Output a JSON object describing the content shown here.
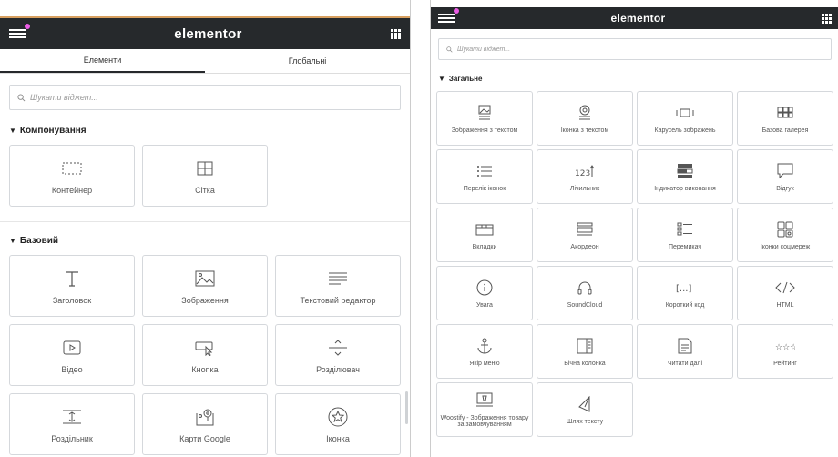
{
  "left": {
    "logo": "elementor",
    "tabs": [
      "Елементи",
      "Глобальні"
    ],
    "search_placeholder": "Шукати віджет...",
    "sections": [
      {
        "title": "Компонування",
        "items": [
          {
            "label": "Контейнер",
            "icon": "container-icon"
          },
          {
            "label": "Сітка",
            "icon": "grid-icon"
          }
        ]
      },
      {
        "title": "Базовий",
        "items": [
          {
            "label": "Заголовок",
            "icon": "heading-icon"
          },
          {
            "label": "Зображення",
            "icon": "image-icon"
          },
          {
            "label": "Текстовий редактор",
            "icon": "text-editor-icon"
          },
          {
            "label": "Відео",
            "icon": "video-icon"
          },
          {
            "label": "Кнопка",
            "icon": "button-icon"
          },
          {
            "label": "Розділювач",
            "icon": "divider-icon"
          },
          {
            "label": "Роздільник",
            "icon": "spacer-icon"
          },
          {
            "label": "Карти Google",
            "icon": "google-maps-icon"
          },
          {
            "label": "Іконка",
            "icon": "star-icon"
          }
        ]
      }
    ]
  },
  "right": {
    "logo": "elementor",
    "search_placeholder": "Шукати віджет...",
    "section_title": "Загальне",
    "items": [
      {
        "label": "Зображення з текстом",
        "icon": "image-box-icon"
      },
      {
        "label": "Іконка з текстом",
        "icon": "icon-box-icon"
      },
      {
        "label": "Карусель зображень",
        "icon": "carousel-icon"
      },
      {
        "label": "Базова галерея",
        "icon": "gallery-icon"
      },
      {
        "label": "Перелік іконок",
        "icon": "icon-list-icon"
      },
      {
        "label": "Лічильник",
        "icon": "counter-icon"
      },
      {
        "label": "Індикатор виконання",
        "icon": "progress-icon"
      },
      {
        "label": "Відгук",
        "icon": "testimonial-icon"
      },
      {
        "label": "Вкладки",
        "icon": "tabs-icon"
      },
      {
        "label": "Акордеон",
        "icon": "accordion-icon"
      },
      {
        "label": "Перемикач",
        "icon": "toggle-icon"
      },
      {
        "label": "Іконки соцмереж",
        "icon": "social-icon"
      },
      {
        "label": "Увага",
        "icon": "alert-icon"
      },
      {
        "label": "SoundCloud",
        "icon": "soundcloud-icon"
      },
      {
        "label": "Короткий код",
        "icon": "shortcode-icon"
      },
      {
        "label": "HTML",
        "icon": "html-icon"
      },
      {
        "label": "Якір меню",
        "icon": "anchor-icon"
      },
      {
        "label": "Бічна колонка",
        "icon": "sidebar-icon"
      },
      {
        "label": "Читати далі",
        "icon": "read-more-icon"
      },
      {
        "label": "Рейтинг",
        "icon": "rating-icon"
      },
      {
        "label": "Woostify - Зображення товару за замовчуванням",
        "icon": "product-image-icon"
      },
      {
        "label": "Шлях тексту",
        "icon": "text-path-icon"
      }
    ]
  },
  "colors": {
    "header_bg": "#26292c",
    "accent": "#ec5de5"
  }
}
